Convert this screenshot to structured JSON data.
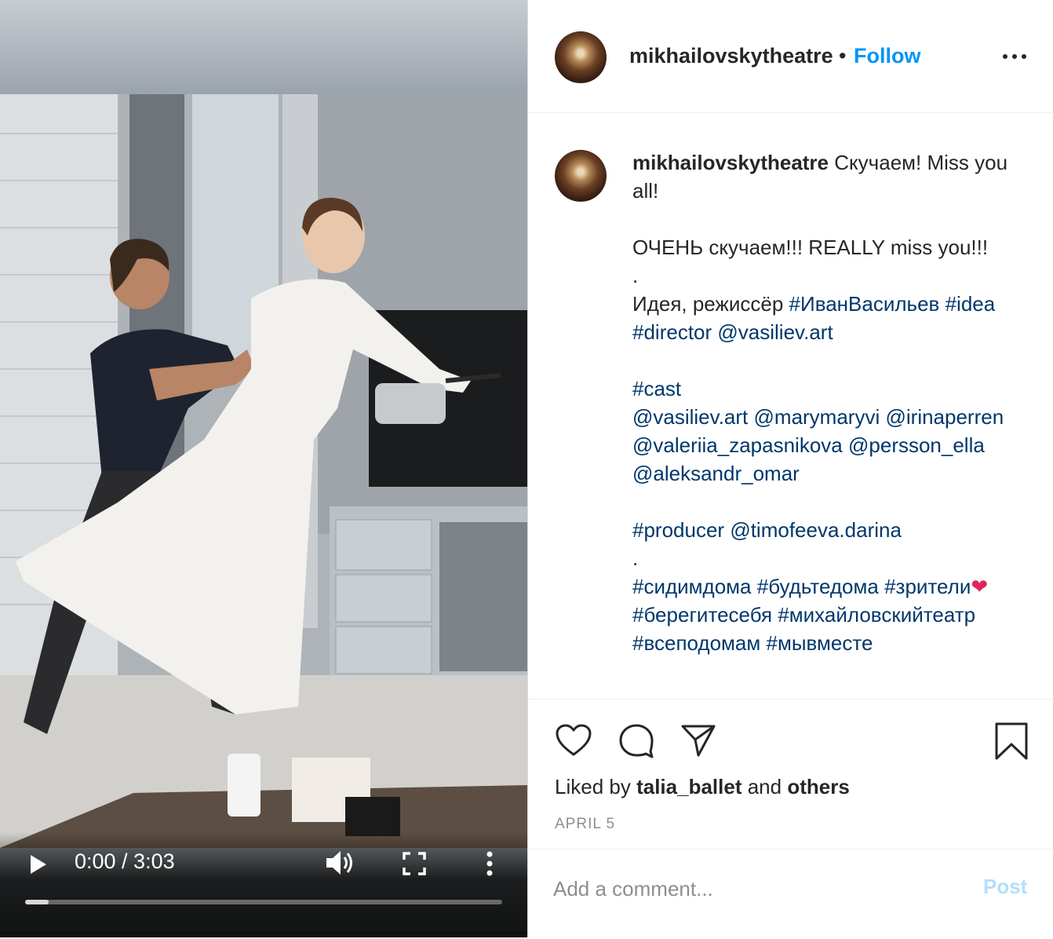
{
  "video": {
    "time_display": "0:00 / 3:03",
    "progress_fraction": 0.05
  },
  "header": {
    "username": "mikhailovskytheatre",
    "dot": "•",
    "follow_label": "Follow"
  },
  "caption": {
    "username": "mikhailovskytheatre",
    "segments": [
      {
        "t": "text",
        "v": " Скучаем! Miss you all!\n\nОЧЕНЬ скучаем!!! REALLY miss you!!!\n.\nИдея, режиссёр "
      },
      {
        "t": "tag",
        "v": "#ИванВасильев"
      },
      {
        "t": "text",
        "v": " "
      },
      {
        "t": "tag",
        "v": "#idea"
      },
      {
        "t": "text",
        "v": " "
      },
      {
        "t": "tag",
        "v": "#director"
      },
      {
        "t": "text",
        "v": " "
      },
      {
        "t": "tag",
        "v": "@vasiliev.art"
      },
      {
        "t": "text",
        "v": "\n\n"
      },
      {
        "t": "tag",
        "v": "#cast"
      },
      {
        "t": "text",
        "v": "\n"
      },
      {
        "t": "tag",
        "v": "@vasiliev.art"
      },
      {
        "t": "text",
        "v": " "
      },
      {
        "t": "tag",
        "v": "@marymaryvi"
      },
      {
        "t": "text",
        "v": " "
      },
      {
        "t": "tag",
        "v": "@irinaperren"
      },
      {
        "t": "text",
        "v": " "
      },
      {
        "t": "tag",
        "v": "@valeriia_zapasnikova"
      },
      {
        "t": "text",
        "v": " "
      },
      {
        "t": "tag",
        "v": "@persson_ella"
      },
      {
        "t": "text",
        "v": " "
      },
      {
        "t": "tag",
        "v": "@aleksandr_omar"
      },
      {
        "t": "text",
        "v": "\n\n"
      },
      {
        "t": "tag",
        "v": "#producer"
      },
      {
        "t": "text",
        "v": " "
      },
      {
        "t": "tag",
        "v": "@timofeeva.darina"
      },
      {
        "t": "text",
        "v": "\n.\n"
      },
      {
        "t": "tag",
        "v": "#сидимдома"
      },
      {
        "t": "text",
        "v": " "
      },
      {
        "t": "tag",
        "v": "#будьтедома"
      },
      {
        "t": "text",
        "v": " "
      },
      {
        "t": "tag",
        "v": "#зрители"
      },
      {
        "t": "heart",
        "v": "❤"
      },
      {
        "t": "text",
        "v": " "
      },
      {
        "t": "tag",
        "v": "#берегитесебя"
      },
      {
        "t": "text",
        "v": " "
      },
      {
        "t": "tag",
        "v": "#михайловскийтеатр"
      },
      {
        "t": "text",
        "v": " "
      },
      {
        "t": "tag",
        "v": "#всеподомам"
      },
      {
        "t": "text",
        "v": " "
      },
      {
        "t": "tag",
        "v": "#мывместе"
      }
    ]
  },
  "actions": {
    "liked_prefix": "Liked by ",
    "liked_user": "talia_ballet",
    "liked_middle": " and ",
    "liked_others": "others",
    "date": "APRIL 5"
  },
  "comment": {
    "placeholder": "Add a comment...",
    "post_label": "Post"
  },
  "colors": {
    "link_blue": "#0095f6",
    "tag_blue": "#00376b",
    "post_disabled": "#b2dffc",
    "heart_red": "#e0245e"
  },
  "icons": [
    "play-icon",
    "volume-icon",
    "fullscreen-icon",
    "more-vertical-icon",
    "more-horizontal-icon",
    "heart-icon",
    "comment-icon",
    "share-icon",
    "bookmark-icon"
  ]
}
